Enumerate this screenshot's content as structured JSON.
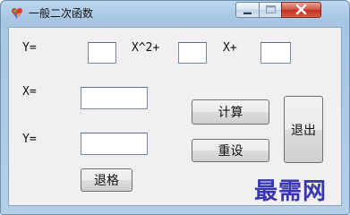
{
  "window": {
    "title": "一般二次函数",
    "icon": "colorful-app-icon"
  },
  "titlebar_buttons": {
    "minimize_icon": "minimize-icon",
    "maximize_icon": "maximize-icon",
    "close_icon": "close-icon",
    "close_color": "#c42b1c"
  },
  "coefficients": {
    "y_label": "Y=",
    "a_suffix": "X^2+",
    "b_suffix": "X+",
    "a_value": "",
    "b_value": "",
    "c_value": ""
  },
  "evaluation": {
    "x_label": "X=",
    "y_label": "Y=",
    "x_value": "",
    "y_value": ""
  },
  "buttons": {
    "calculate": "计算",
    "reset": "重设",
    "exit": "退出",
    "backspace": "退格"
  },
  "watermark": "最需网"
}
